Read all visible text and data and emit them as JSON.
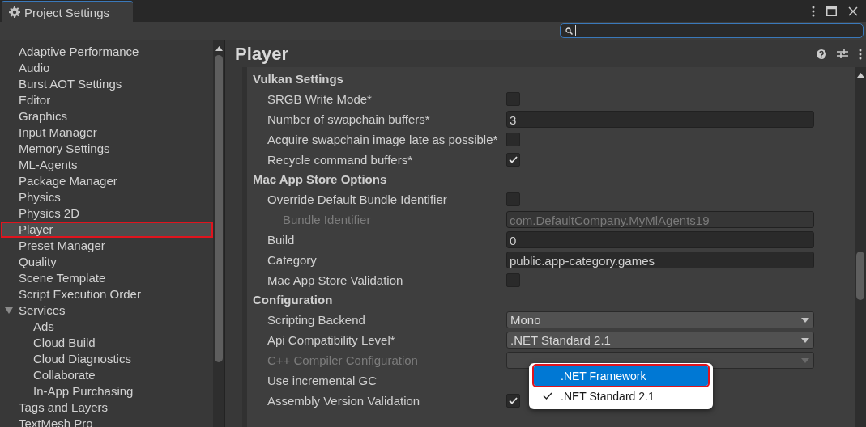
{
  "window": {
    "title": "Project Settings"
  },
  "sidebar": {
    "items": [
      {
        "label": "Adaptive Performance",
        "selected": false
      },
      {
        "label": "Audio",
        "selected": false
      },
      {
        "label": "Burst AOT Settings",
        "selected": false
      },
      {
        "label": "Editor",
        "selected": false
      },
      {
        "label": "Graphics",
        "selected": false
      },
      {
        "label": "Input Manager",
        "selected": false
      },
      {
        "label": "Memory Settings",
        "selected": false
      },
      {
        "label": "ML-Agents",
        "selected": false
      },
      {
        "label": "Package Manager",
        "selected": false
      },
      {
        "label": "Physics",
        "selected": false
      },
      {
        "label": "Physics 2D",
        "selected": false
      },
      {
        "label": "Player",
        "selected": true
      },
      {
        "label": "Preset Manager",
        "selected": false
      },
      {
        "label": "Quality",
        "selected": false
      },
      {
        "label": "Scene Template",
        "selected": false
      },
      {
        "label": "Script Execution Order",
        "selected": false
      },
      {
        "label": "Services",
        "selected": false,
        "expanded": true,
        "children": [
          {
            "label": "Ads",
            "selected": false
          },
          {
            "label": "Cloud Build",
            "selected": false
          },
          {
            "label": "Cloud Diagnostics",
            "selected": false
          },
          {
            "label": "Collaborate",
            "selected": false
          },
          {
            "label": "In-App Purchasing",
            "selected": false
          }
        ]
      },
      {
        "label": "Tags and Layers",
        "selected": false
      },
      {
        "label": "TextMesh Pro",
        "selected": false
      }
    ]
  },
  "panel": {
    "title": "Player",
    "sections": [
      {
        "title": "Vulkan Settings",
        "rows": [
          {
            "label": "SRGB Write Mode*",
            "kind": "checkbox",
            "checked": false
          },
          {
            "label": "Number of swapchain buffers*",
            "kind": "text",
            "value": "3"
          },
          {
            "label": "Acquire swapchain image late as possible*",
            "kind": "checkbox",
            "checked": false
          },
          {
            "label": "Recycle command buffers*",
            "kind": "checkbox",
            "checked": true
          }
        ]
      },
      {
        "title": "Mac App Store Options",
        "rows": [
          {
            "label": "Override Default Bundle Identifier",
            "kind": "checkbox",
            "checked": false
          },
          {
            "label": "Bundle Identifier",
            "kind": "text",
            "value": "com.DefaultCompany.MyMlAgents19",
            "disabled": true,
            "indented": true
          },
          {
            "label": "Build",
            "kind": "text",
            "value": "0"
          },
          {
            "label": "Category",
            "kind": "text",
            "value": "public.app-category.games"
          },
          {
            "label": "Mac App Store Validation",
            "kind": "checkbox",
            "checked": false
          }
        ]
      },
      {
        "title": "Configuration",
        "rows": [
          {
            "label": "Scripting Backend",
            "kind": "dropdown",
            "value": "Mono"
          },
          {
            "label": "Api Compatibility Level*",
            "kind": "dropdown",
            "value": ".NET Standard 2.1"
          },
          {
            "label": "C++ Compiler Configuration",
            "kind": "dropdown",
            "disabled": true
          },
          {
            "label": "Use incremental GC",
            "kind": "label"
          },
          {
            "label": "Assembly Version Validation",
            "kind": "checkbox",
            "checked": true
          }
        ]
      }
    ]
  },
  "popup": {
    "options": [
      {
        "label": ".NET Framework",
        "highlighted": true,
        "checked": false
      },
      {
        "label": ".NET Standard 2.1",
        "highlighted": false,
        "checked": true
      }
    ]
  }
}
